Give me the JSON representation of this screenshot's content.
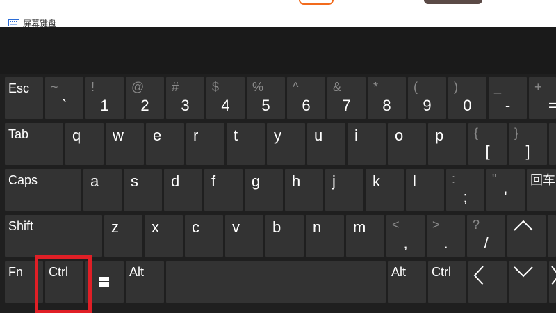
{
  "window": {
    "title": "屏幕键盘"
  },
  "keyboard": {
    "row1": [
      {
        "name": "key-esc",
        "label": "Esc"
      },
      {
        "name": "key-backtick",
        "top": "~",
        "bottom": "`"
      },
      {
        "name": "key-1",
        "top": "!",
        "bottom": "1"
      },
      {
        "name": "key-2",
        "top": "@",
        "bottom": "2"
      },
      {
        "name": "key-3",
        "top": "#",
        "bottom": "3"
      },
      {
        "name": "key-4",
        "top": "$",
        "bottom": "4"
      },
      {
        "name": "key-5",
        "top": "%",
        "bottom": "5"
      },
      {
        "name": "key-6",
        "top": "^",
        "bottom": "6"
      },
      {
        "name": "key-7",
        "top": "&",
        "bottom": "7"
      },
      {
        "name": "key-8",
        "top": "*",
        "bottom": "8"
      },
      {
        "name": "key-9",
        "top": "(",
        "bottom": "9"
      },
      {
        "name": "key-0",
        "top": ")",
        "bottom": "0"
      },
      {
        "name": "key-minus",
        "top": "_",
        "bottom": "-"
      },
      {
        "name": "key-equals",
        "top": "+",
        "bottom": "="
      }
    ],
    "row2": [
      {
        "name": "key-tab",
        "label": "Tab"
      },
      {
        "name": "key-q",
        "char": "q"
      },
      {
        "name": "key-w",
        "char": "w"
      },
      {
        "name": "key-e",
        "char": "e"
      },
      {
        "name": "key-r",
        "char": "r"
      },
      {
        "name": "key-t",
        "char": "t"
      },
      {
        "name": "key-y",
        "char": "y"
      },
      {
        "name": "key-u",
        "char": "u"
      },
      {
        "name": "key-i",
        "char": "i"
      },
      {
        "name": "key-o",
        "char": "o"
      },
      {
        "name": "key-p",
        "char": "p"
      },
      {
        "name": "key-open-bracket",
        "top": "{",
        "bottom": "["
      },
      {
        "name": "key-close-bracket",
        "top": "}",
        "bottom": "]"
      },
      {
        "name": "key-backslash",
        "top": "",
        "bottom": ""
      }
    ],
    "row3": [
      {
        "name": "key-caps",
        "label": "Caps"
      },
      {
        "name": "key-a",
        "char": "a"
      },
      {
        "name": "key-s",
        "char": "s"
      },
      {
        "name": "key-d",
        "char": "d"
      },
      {
        "name": "key-f",
        "char": "f"
      },
      {
        "name": "key-g",
        "char": "g"
      },
      {
        "name": "key-h",
        "char": "h"
      },
      {
        "name": "key-j",
        "char": "j"
      },
      {
        "name": "key-k",
        "char": "k"
      },
      {
        "name": "key-l",
        "char": "l"
      },
      {
        "name": "key-semicolon",
        "top": ":",
        "bottom": ";"
      },
      {
        "name": "key-quote",
        "top": "\"",
        "bottom": "'"
      },
      {
        "name": "key-enter",
        "label": "回车"
      }
    ],
    "row4": [
      {
        "name": "key-shift-left",
        "label": "Shift"
      },
      {
        "name": "key-z",
        "char": "z"
      },
      {
        "name": "key-x",
        "char": "x"
      },
      {
        "name": "key-c",
        "char": "c"
      },
      {
        "name": "key-v",
        "char": "v"
      },
      {
        "name": "key-b",
        "char": "b"
      },
      {
        "name": "key-n",
        "char": "n"
      },
      {
        "name": "key-m",
        "char": "m"
      },
      {
        "name": "key-comma",
        "top": "<",
        "bottom": ","
      },
      {
        "name": "key-period",
        "top": ">",
        "bottom": "."
      },
      {
        "name": "key-slash",
        "top": "?",
        "bottom": "/"
      },
      {
        "name": "key-arrow-up",
        "icon": "arrow-up-icon"
      },
      {
        "name": "key-shift-right",
        "label": ""
      }
    ],
    "row5": [
      {
        "name": "key-fn",
        "label": "Fn"
      },
      {
        "name": "key-ctrl-left",
        "label": "Ctrl"
      },
      {
        "name": "key-windows",
        "icon": "windows-logo-icon"
      },
      {
        "name": "key-alt-left",
        "label": "Alt"
      },
      {
        "name": "key-space",
        "label": ""
      },
      {
        "name": "key-alt-right",
        "label": "Alt"
      },
      {
        "name": "key-ctrl-right",
        "label": "Ctrl"
      },
      {
        "name": "key-arrow-left",
        "icon": "arrow-left-icon"
      },
      {
        "name": "key-arrow-down",
        "icon": "arrow-down-icon"
      },
      {
        "name": "key-arrow-right",
        "icon": "arrow-right-icon"
      }
    ]
  },
  "highlight": {
    "target": "key-ctrl-left",
    "color": "#e01f26"
  },
  "colors": {
    "key_bg": "#333333",
    "keyboard_bg": "#1f1f1f",
    "label": "#ffffff",
    "shift_char": "#8a8a8a"
  }
}
